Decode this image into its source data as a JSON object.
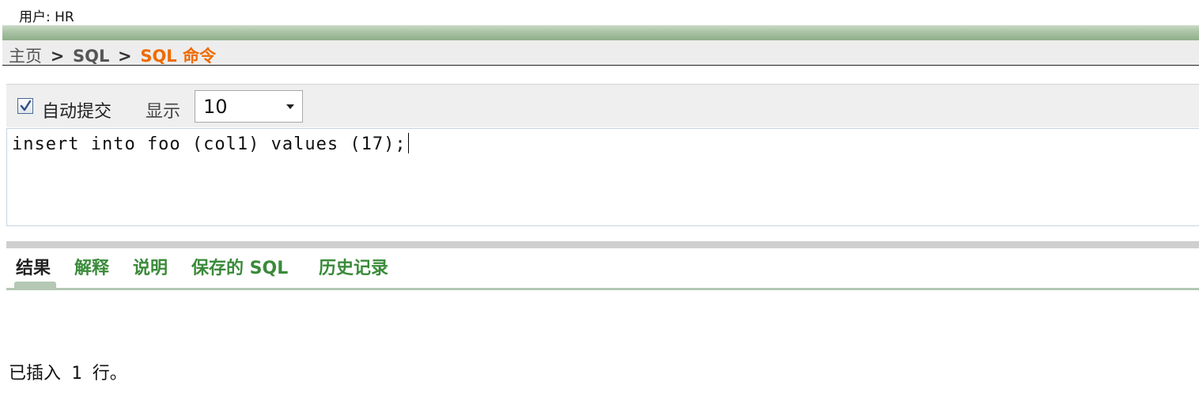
{
  "header": {
    "user_line": "用户: HR"
  },
  "breadcrumb": {
    "home": "主页",
    "separator": ">",
    "sql": "SQL",
    "current": "SQL 命令"
  },
  "toolbar": {
    "autocommit_label": "自动提交",
    "autocommit_checked": true,
    "display_label": "显示",
    "rows_value": "10"
  },
  "editor": {
    "sql_text": "insert into foo (col1) values (17);"
  },
  "tabs": [
    {
      "label": "结果",
      "active": true
    },
    {
      "label": "解释",
      "active": false
    },
    {
      "label": "说明",
      "active": false
    },
    {
      "label": "保存的 SQL",
      "active": false
    },
    {
      "label": "历史记录",
      "active": false
    }
  ],
  "result": {
    "message": "已插入 1 行。"
  },
  "colors": {
    "breadcrumb_current": "#ef6a00",
    "tab_link": "#3a8a3a",
    "header_strip": "#a9c3a4"
  }
}
